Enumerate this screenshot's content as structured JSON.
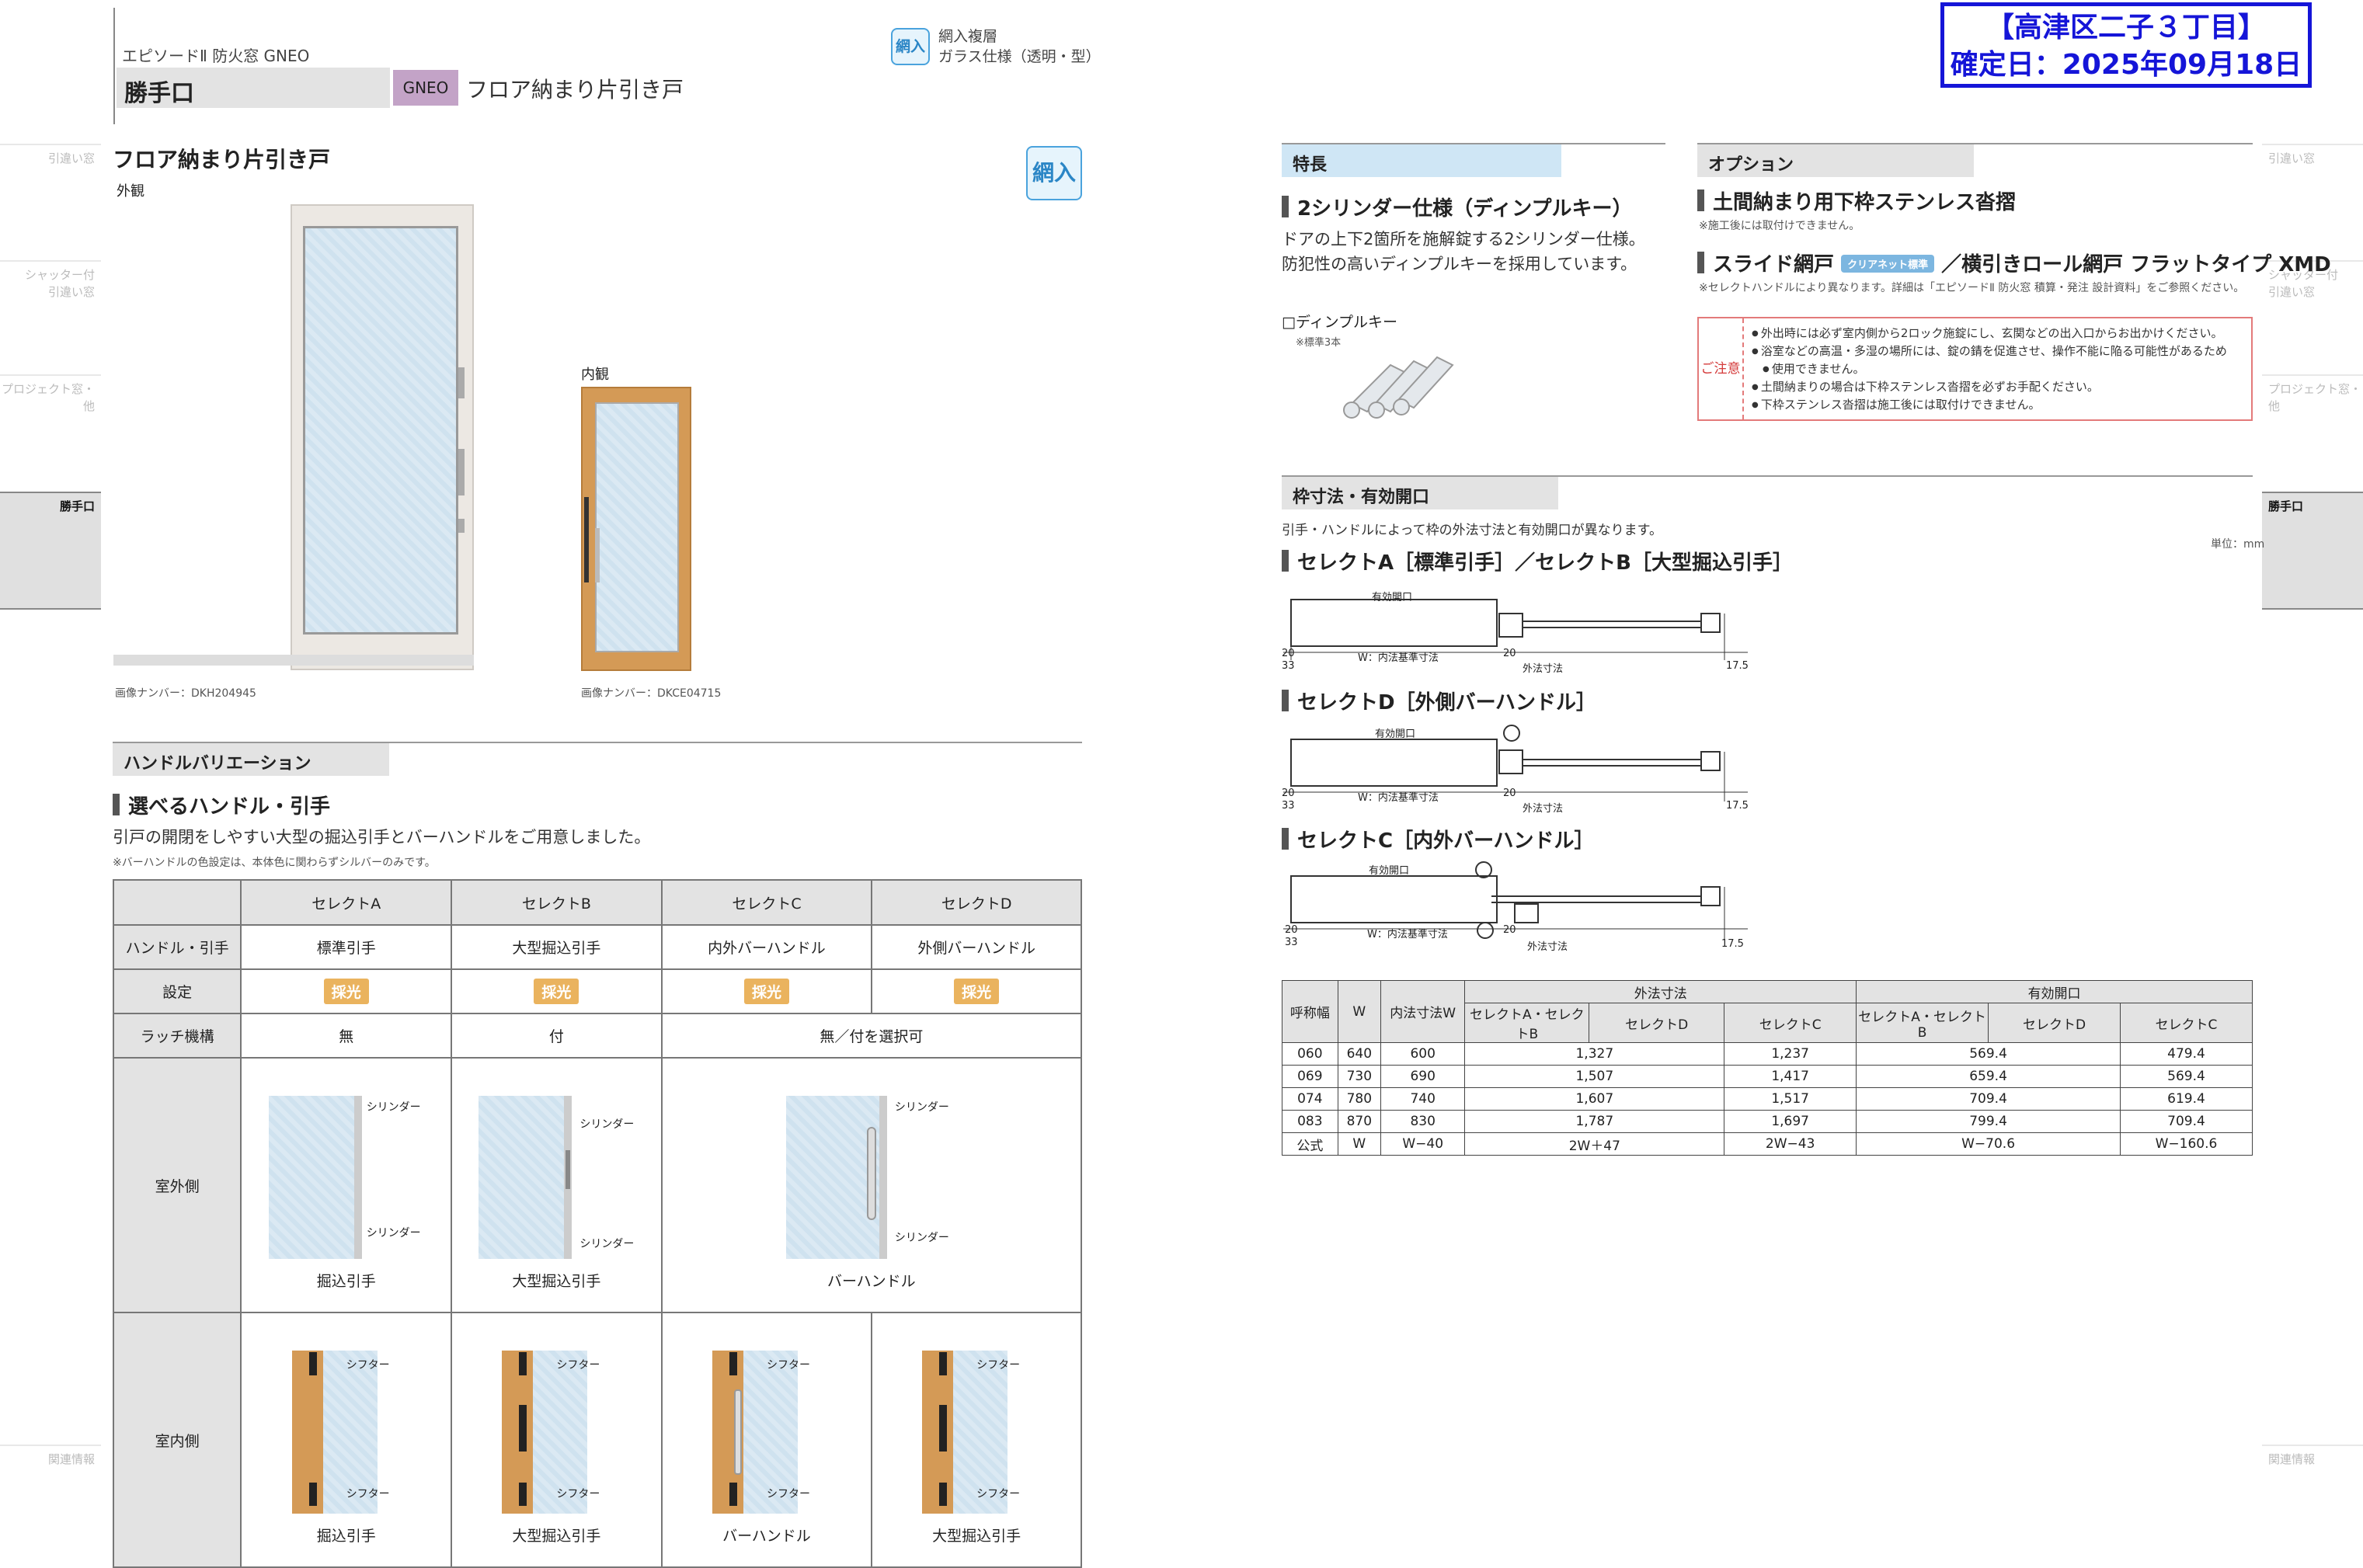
{
  "left_side": [
    {
      "label": "引違い窓",
      "active": false
    },
    {
      "label": "シャッター付\n引違い窓",
      "active": false
    },
    {
      "label": "プロジェクト窓・\n他",
      "active": false
    },
    {
      "label": "勝手口",
      "active": true
    },
    {
      "label": "関連情報",
      "active": false
    }
  ],
  "right_side": [
    {
      "label": "引違い窓",
      "active": false
    },
    {
      "label": "シャッター付\n引違い窓",
      "active": false
    },
    {
      "label": "プロジェクト窓・\n他",
      "active": false
    },
    {
      "label": "勝手口",
      "active": true
    },
    {
      "label": "関連情報",
      "active": false
    }
  ],
  "header": {
    "series": "エピソードⅡ 防火窓 GNEO",
    "category": "勝手口",
    "gneo_badge": "GNEO",
    "product": "フロア納まり片引き戸",
    "ami_chip": "網入",
    "glass_spec_line1": "網入複層",
    "glass_spec_line2": "ガラス仕様（透明・型）"
  },
  "stamp": {
    "line1": "【高津区二子３丁目】",
    "line2": "確定日：2025年09月18日"
  },
  "product_section": {
    "title": "フロア納まり片引き戸",
    "ami_chip": "網入",
    "exterior_label": "外観",
    "interior_label": "内観",
    "exterior_image_no": "画像ナンバー：DKH204945",
    "interior_image_no": "画像ナンバー：DKCE04715"
  },
  "handle_section": {
    "title": "ハンドルバリエーション",
    "subhead": "選べるハンドル・引手",
    "desc": "引戸の開閉をしやすい大型の掘込引手とバーハンドルをご用意しました。",
    "note": "※バーハンドルの色設定は、本体色に関わらずシルバーのみです。",
    "columns": [
      "セレクトA",
      "セレクトB",
      "セレクトC",
      "セレクトD"
    ],
    "row_labels": {
      "handle": "ハンドル・引手",
      "setting": "設定",
      "latch": "ラッチ機構",
      "exterior": "室外側",
      "interior": "室内側"
    },
    "handle_values": [
      "標準引手",
      "大型掘込引手",
      "内外バーハンドル",
      "外側バーハンドル"
    ],
    "setting_chip": "採光",
    "latch_values": [
      "無",
      "付",
      "無／付を選択可"
    ],
    "cylinder": "シリンダー",
    "shifter": "シフター",
    "exterior_captions": [
      "掘込引手",
      "大型掘込引手",
      "バーハンドル"
    ],
    "interior_captions": [
      "掘込引手",
      "大型掘込引手",
      "バーハンドル",
      "大型掘込引手"
    ]
  },
  "features": {
    "title": "特長",
    "subhead": "2シリンダー仕様（ディンプルキー）",
    "desc_line1": "ドアの上下2箇所を施解錠する2シリンダー仕様。",
    "desc_line2": "防犯性の高いディンプルキーを採用しています。",
    "key_label": "□ディンプルキー",
    "key_note": "※標準3本"
  },
  "options": {
    "title": "オプション",
    "item1": "土間納まり用下枠ステンレス沓摺",
    "item1_note": "※施工後には取付けできません。",
    "item2_a": "スライド網戸",
    "item2_tag": "クリアネット標準",
    "item2_b": "／横引きロール網戸 フラットタイプ XMD",
    "item2_note": "※セレクトハンドルにより異なります。詳細は「エピソードⅡ 防火窓 積算・発注 設計資料」をご参照ください。",
    "caution_label": "ご注意",
    "caution_items": [
      "外出時には必ず室内側から2ロック施錠にし、玄関などの出入口からお出かけください。",
      "浴室などの高温・多湿の場所には、錠の錆を促進させ、操作不能に陥る可能性があるため",
      "使用できません。",
      "土間納まりの場合は下枠ステンレス沓摺を必ずお手配ください。",
      "下枠ステンレス沓摺は施工後には取付けできません。"
    ]
  },
  "dimensions": {
    "title": "枠寸法・有効開口",
    "desc": "引手・ハンドルによって枠の外法寸法と有効開口が異なります。",
    "unit": "単位：mm",
    "diagram_ab": "セレクトA［標準引手］／セレクトB［大型掘込引手］",
    "diagram_d": "セレクトD［外側バーハンドル］",
    "diagram_c": "セレクトC［内外バーハンドル］",
    "lbl_opening": "有効開口",
    "lbl_inner": "W：内法基準寸法",
    "lbl_outer": "外法寸法",
    "n20": "20",
    "n33": "33",
    "n175": "17.5"
  },
  "size_table": {
    "h_name": "呼称幅",
    "h_w": "W",
    "h_inner": "内法寸法W",
    "h_outer": "外法寸法",
    "h_open": "有効開口",
    "h_ab": "セレクトA・セレクトB",
    "h_d": "セレクトD",
    "h_c": "セレクトC",
    "rows": [
      [
        "060",
        "640",
        "600",
        "1,327",
        "1,237",
        "569.4",
        "479.4"
      ],
      [
        "069",
        "730",
        "690",
        "1,507",
        "1,417",
        "659.4",
        "569.4"
      ],
      [
        "074",
        "780",
        "740",
        "1,607",
        "1,517",
        "709.4",
        "619.4"
      ],
      [
        "083",
        "870",
        "830",
        "1,787",
        "1,697",
        "799.4",
        "709.4"
      ],
      [
        "公式",
        "W",
        "W−40",
        "2W＋47",
        "2W−43",
        "W−70.6",
        "W−160.6"
      ]
    ]
  }
}
